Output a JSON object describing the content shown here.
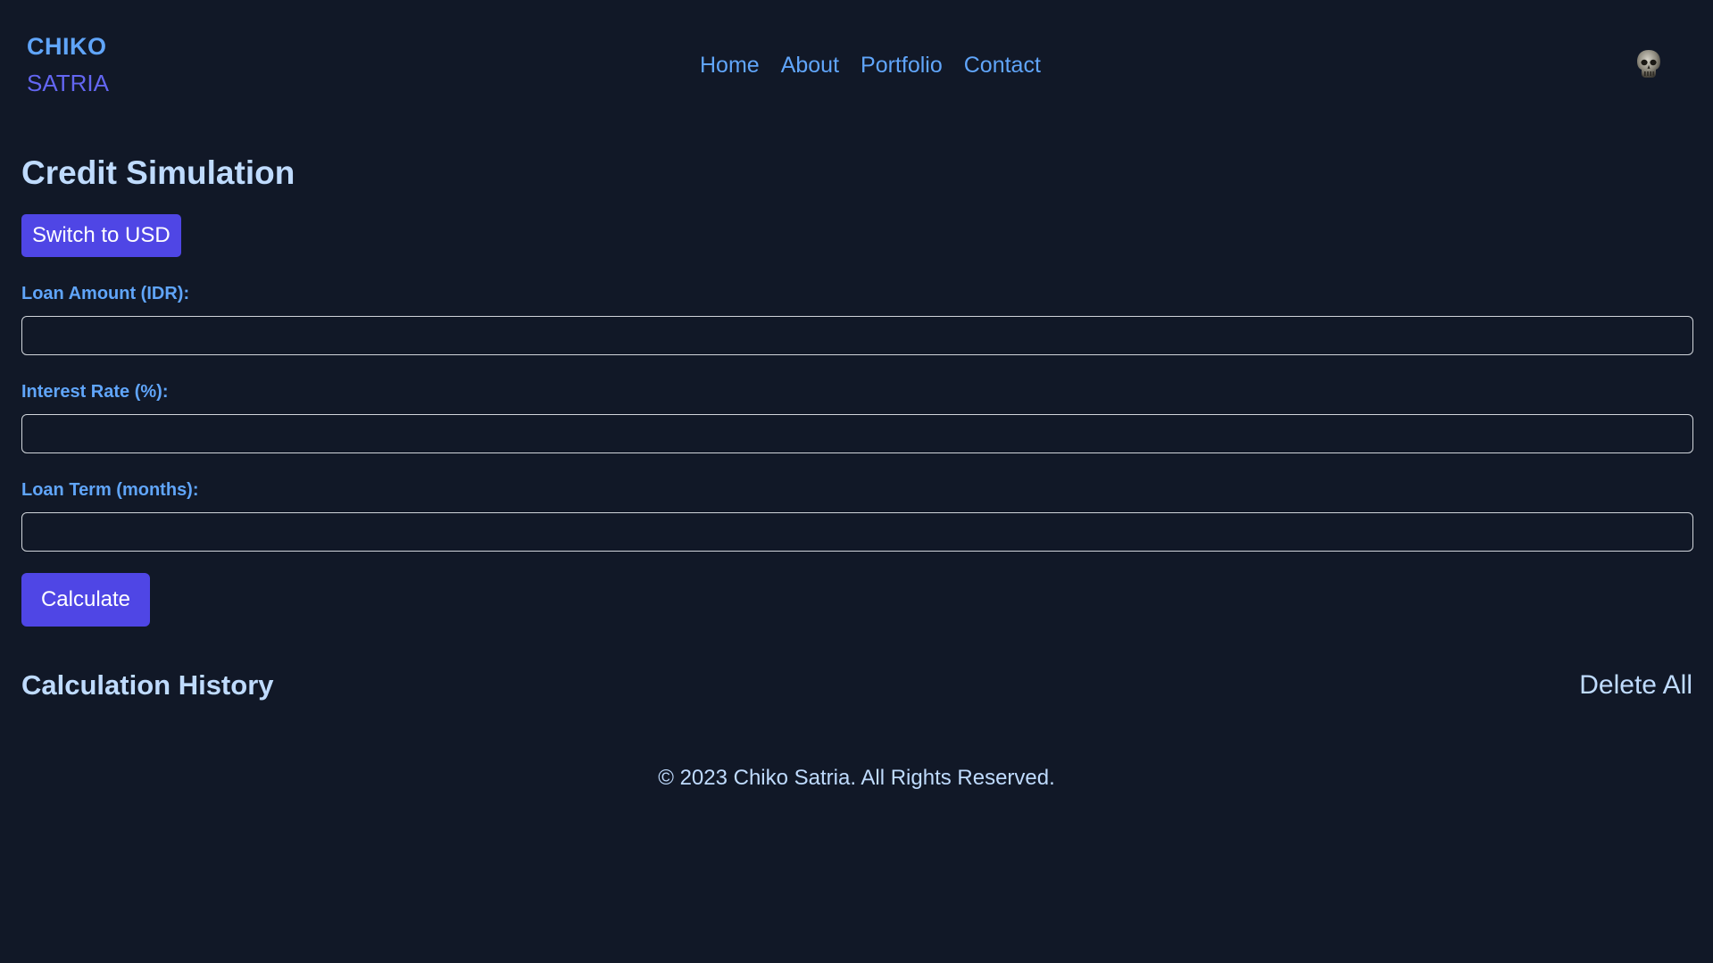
{
  "header": {
    "brand_top": "CHIKO",
    "brand_bottom": "SATRIA",
    "nav": {
      "home": "Home",
      "about": "About",
      "portfolio": "Portfolio",
      "contact": "Contact"
    },
    "avatar_icon": "skull-icon"
  },
  "main": {
    "title": "Credit Simulation",
    "switch_currency_label": "Switch to USD",
    "fields": {
      "loan_amount_label": "Loan Amount (IDR):",
      "loan_amount_value": "",
      "interest_rate_label": "Interest Rate (%):",
      "interest_rate_value": "",
      "loan_term_label": "Loan Term (months):",
      "loan_term_value": ""
    },
    "calculate_label": "Calculate",
    "history_title": "Calculation History",
    "delete_all_label": "Delete All"
  },
  "footer": {
    "text": "© 2023 Chiko Satria. All Rights Reserved."
  },
  "colors": {
    "background": "#111827",
    "accent": "#4f46e5",
    "link": "#60a5fa",
    "text": "#bfdbfe"
  }
}
